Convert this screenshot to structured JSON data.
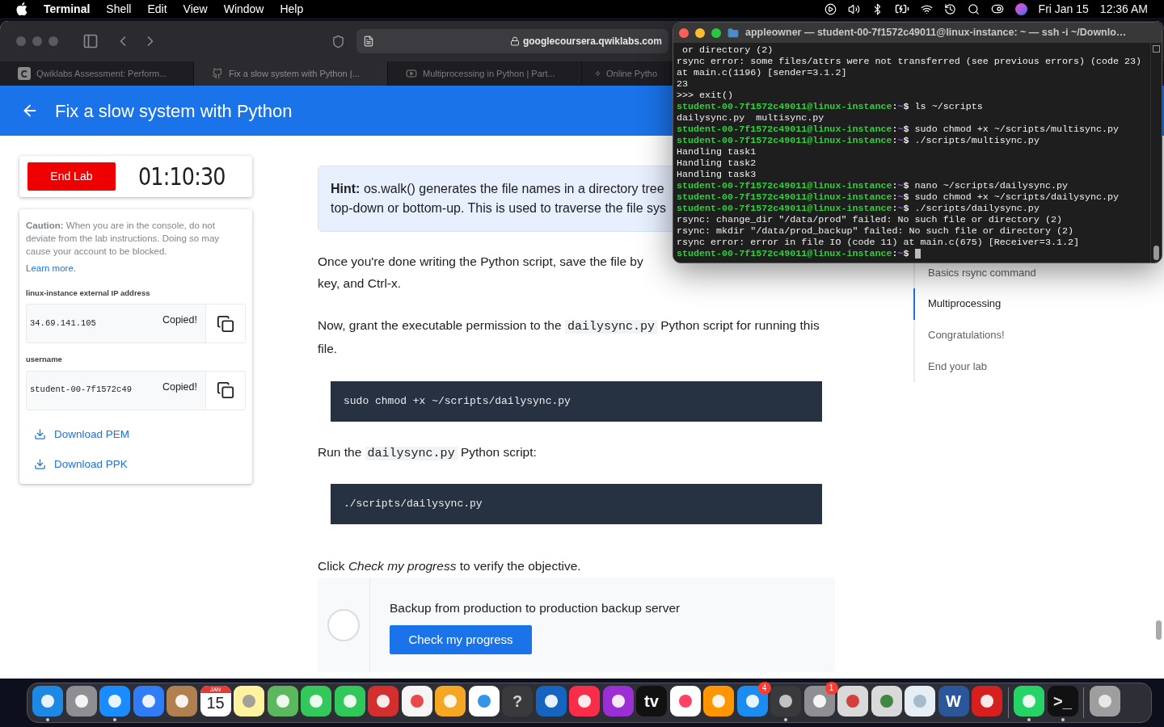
{
  "menu_bar": {
    "app": "Terminal",
    "items": [
      "Shell",
      "Edit",
      "View",
      "Window",
      "Help"
    ],
    "date": "Fri Jan 15",
    "time": "12:36 AM"
  },
  "browser": {
    "url": "googlecoursera.qwiklabs.com",
    "tabs": [
      {
        "title": "Qwiklabs Assessment: Perform...",
        "selected": false
      },
      {
        "title": "Fix a slow system with Python |...",
        "selected": true
      },
      {
        "title": "Multiprocessing in Python | Part...",
        "selected": false
      },
      {
        "title": "Online Pytho",
        "selected": false
      }
    ],
    "header_title": "Fix a slow system with Python"
  },
  "lab_panel": {
    "end_button": "End Lab",
    "timer": "01:10:30",
    "caution": "**Caution:** When you are in the console, do not deviate from the lab instructions. Doing so may cause your account to be blocked.",
    "learn_more": "Learn more.",
    "fields": [
      {
        "label": "linux-instance external IP address",
        "value": "34.69.141.105",
        "status": "Copied!"
      },
      {
        "label": "username",
        "value": "student-00-7f1572c49",
        "status": "Copied!"
      }
    ],
    "downloads": [
      "Download PEM",
      "Download PPK"
    ]
  },
  "content": {
    "hint_lines": [
      "**Hint:** os.walk() generates the file names in a directory tree",
      "top-down or bottom-up. This is used to traverse the file sys"
    ],
    "blocks": [
      {
        "kind": "lines",
        "lines": [
          "Once you're done writing the Python script, save the file by",
          "key, and Ctrl-x."
        ]
      },
      {
        "kind": "paragraph",
        "parts": [
          {
            "kind": "text",
            "text": "Now, grant the executable permission to the "
          },
          {
            "kind": "code",
            "text": "dailysync.py"
          },
          {
            "kind": "text",
            "text": " Python script for running this file."
          }
        ]
      },
      {
        "kind": "codeblock",
        "text": "sudo chmod +x ~/scripts/dailysync.py"
      },
      {
        "kind": "paragraph",
        "parts": [
          {
            "kind": "text",
            "text": "Run the "
          },
          {
            "kind": "code",
            "text": "dailysync.py"
          },
          {
            "kind": "text",
            "text": " Python script:"
          }
        ]
      },
      {
        "kind": "codeblock",
        "text": "./scripts/dailysync.py"
      },
      {
        "kind": "paragraph",
        "parts": [
          {
            "kind": "text",
            "text": "Click *Check my progress* to verify the objective."
          }
        ]
      }
    ],
    "progress": {
      "title": "Backup from production to production backup server",
      "button": "Check my progress",
      "done": false
    }
  },
  "toc": [
    {
      "label": "Basics rsync command",
      "selected": false
    },
    {
      "label": "Multiprocessing",
      "selected": true
    },
    {
      "label": "Congratulations!",
      "selected": false
    },
    {
      "label": "End your lab",
      "selected": false
    }
  ],
  "terminal": {
    "title": "appleowner — student-00-7f1572c49011@linux-instance: ~ — ssh -i ~/Downlo…",
    "lines": [
      {
        "kind": "output",
        "text": " or directory (2)"
      },
      {
        "kind": "output",
        "text": "rsync error: some files/attrs were not transferred (see previous errors) (code 23)"
      },
      {
        "kind": "output",
        "text": "at main.c(1196) [sender=3.1.2]"
      },
      {
        "kind": "output",
        "text": "23"
      },
      {
        "kind": "output",
        "text": ">>> exit()"
      },
      {
        "kind": "prompt",
        "host": "student-00-7f1572c49011@linux-instance",
        "sep": ":",
        "dir": "~",
        "sign": "$",
        "command": "ls ~/scripts",
        "cursor": false
      },
      {
        "kind": "output",
        "text": "dailysync.py  multisync.py"
      },
      {
        "kind": "prompt",
        "host": "student-00-7f1572c49011@linux-instance",
        "sep": ":",
        "dir": "~",
        "sign": "$",
        "command": "sudo chmod +x ~/scripts/multisync.py",
        "cursor": false
      },
      {
        "kind": "prompt",
        "host": "student-00-7f1572c49011@linux-instance",
        "sep": ":",
        "dir": "~",
        "sign": "$",
        "command": "./scripts/multisync.py",
        "cursor": false
      },
      {
        "kind": "output",
        "text": "Handling task1"
      },
      {
        "kind": "output",
        "text": "Handling task2"
      },
      {
        "kind": "output",
        "text": "Handling task3"
      },
      {
        "kind": "prompt",
        "host": "student-00-7f1572c49011@linux-instance",
        "sep": ":",
        "dir": "~",
        "sign": "$",
        "command": "nano ~/scripts/dailysync.py",
        "cursor": false
      },
      {
        "kind": "prompt",
        "host": "student-00-7f1572c49011@linux-instance",
        "sep": ":",
        "dir": "~",
        "sign": "$",
        "command": "sudo chmod +x ~/scripts/dailysync.py",
        "cursor": false
      },
      {
        "kind": "prompt",
        "host": "student-00-7f1572c49011@linux-instance",
        "sep": ":",
        "dir": "~",
        "sign": "$",
        "command": "./scripts/dailysync.py",
        "cursor": false
      },
      {
        "kind": "output",
        "text": "rsync: change_dir \"/data/prod\" failed: No such file or directory (2)"
      },
      {
        "kind": "output",
        "text": "rsync: mkdir \"/data/prod_backup\" failed: No such file or directory (2)"
      },
      {
        "kind": "output",
        "text": "rsync error: error in file IO (code 11) at main.c(675) [Receiver=3.1.2]"
      },
      {
        "kind": "prompt",
        "host": "student-00-7f1572c49011@linux-instance",
        "sep": ":",
        "dir": "~",
        "sign": "$",
        "cursor": true
      }
    ]
  },
  "dock": [
    {
      "kind": "app",
      "running": true
    },
    {
      "kind": "app",
      "running": false
    },
    {
      "kind": "app",
      "running": true
    },
    {
      "kind": "app",
      "running": false
    },
    {
      "kind": "app",
      "running": false
    },
    {
      "kind": "calendar",
      "month": "JAN",
      "day": "15",
      "running": false
    },
    {
      "kind": "app",
      "running": false
    },
    {
      "kind": "app",
      "running": false
    },
    {
      "kind": "app",
      "running": false
    },
    {
      "kind": "app",
      "running": false
    },
    {
      "kind": "app",
      "running": false
    },
    {
      "kind": "app",
      "running": false
    },
    {
      "kind": "app",
      "running": false
    },
    {
      "kind": "app",
      "running": false
    },
    {
      "kind": "glyph",
      "text": "?",
      "running": false
    },
    {
      "kind": "app",
      "running": false
    },
    {
      "kind": "app",
      "running": false
    },
    {
      "kind": "app",
      "running": false
    },
    {
      "kind": "glyph",
      "text": "tv",
      "running": false
    },
    {
      "kind": "app",
      "running": false
    },
    {
      "kind": "app",
      "running": false
    },
    {
      "kind": "app",
      "running": false,
      "badge": "4"
    },
    {
      "kind": "app",
      "running": true
    },
    {
      "kind": "app",
      "running": false,
      "badge": "1"
    },
    {
      "kind": "app",
      "running": false
    },
    {
      "kind": "app",
      "running": false
    },
    {
      "kind": "app",
      "running": false
    },
    {
      "kind": "glyph",
      "text": "W",
      "running": false
    },
    {
      "kind": "app",
      "running": false
    },
    {
      "kind": "separator"
    },
    {
      "kind": "app",
      "running": true
    },
    {
      "kind": "glyph",
      "text": ">_",
      "running": true
    },
    {
      "kind": "separator"
    },
    {
      "kind": "app",
      "running": false
    }
  ]
}
